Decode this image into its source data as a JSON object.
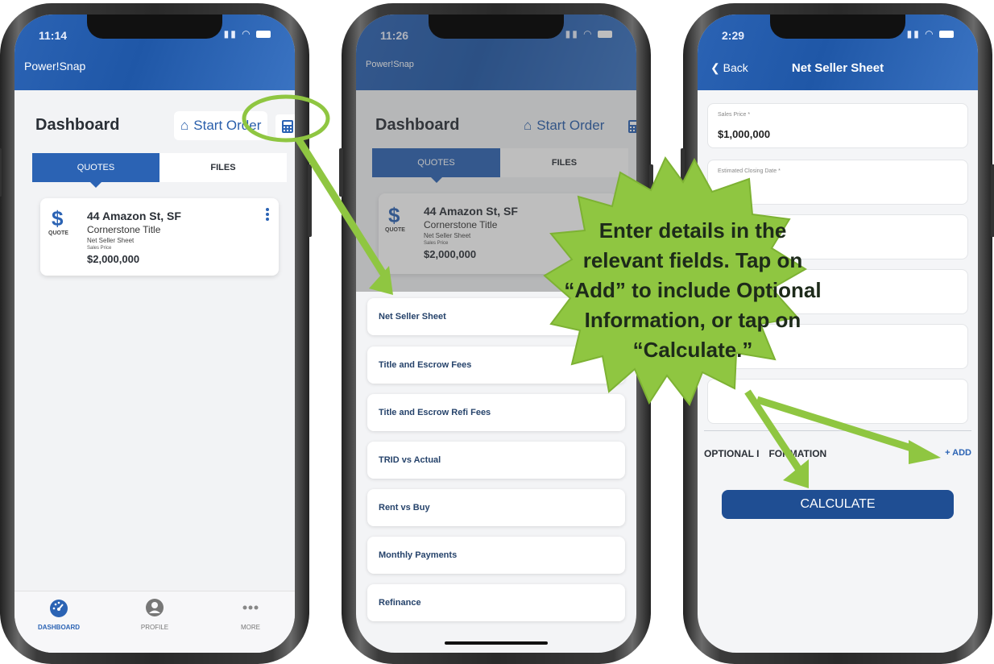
{
  "phone1": {
    "status_time": "11:14",
    "app_title": "Power!Snap",
    "dashboard_title": "Dashboard",
    "start_order_label": "Start Order",
    "tabs": [
      "QUOTES",
      "FILES"
    ],
    "quote": {
      "type_label": "QUOTE",
      "address": "44 Amazon St, SF",
      "company": "Cornerstone Title",
      "sheet_type": "Net Seller Sheet",
      "price_label": "Sales Price",
      "price": "$2,000,000"
    },
    "bottom_nav": [
      "DASHBOARD",
      "PROFILE",
      "MORE"
    ]
  },
  "phone2": {
    "status_time": "11:26",
    "app_title": "Power!Snap",
    "dashboard_title": "Dashboard",
    "start_order_label": "Start Order",
    "tabs": [
      "QUOTES",
      "FILES"
    ],
    "quote": {
      "type_label": "QUOTE",
      "address": "44 Amazon St, SF",
      "company": "Cornerstone Title",
      "sheet_type": "Net Seller Sheet",
      "price_label": "Sales Price",
      "price": "$2,000,000"
    },
    "menu_items": [
      "Net Seller Sheet",
      "Title and Escrow Fees",
      "Title and Escrow Refi Fees",
      "TRID vs Actual",
      "Rent vs Buy",
      "Monthly Payments",
      "Refinance"
    ]
  },
  "phone3": {
    "status_time": "2:29",
    "back_label": "Back",
    "title": "Net Seller Sheet",
    "fields": [
      {
        "label": "Sales Price *",
        "value": "$1,000,000"
      },
      {
        "label": "Estimated Closing Date *",
        "value": ""
      }
    ],
    "optional_label_left": "OPTIONAL I",
    "optional_label_right": "FORMATION",
    "add_label": "+ ADD",
    "calculate_label": "CALCULATE"
  },
  "callout": {
    "lines": [
      "Enter details in the",
      "relevant fields. Tap on",
      "“Add” to include Optional",
      "Information, or tap on",
      "“Calculate.”"
    ]
  },
  "colors": {
    "brand_blue": "#2b63b4",
    "button_blue": "#1f4e93",
    "annotation_green": "#8fc641"
  }
}
